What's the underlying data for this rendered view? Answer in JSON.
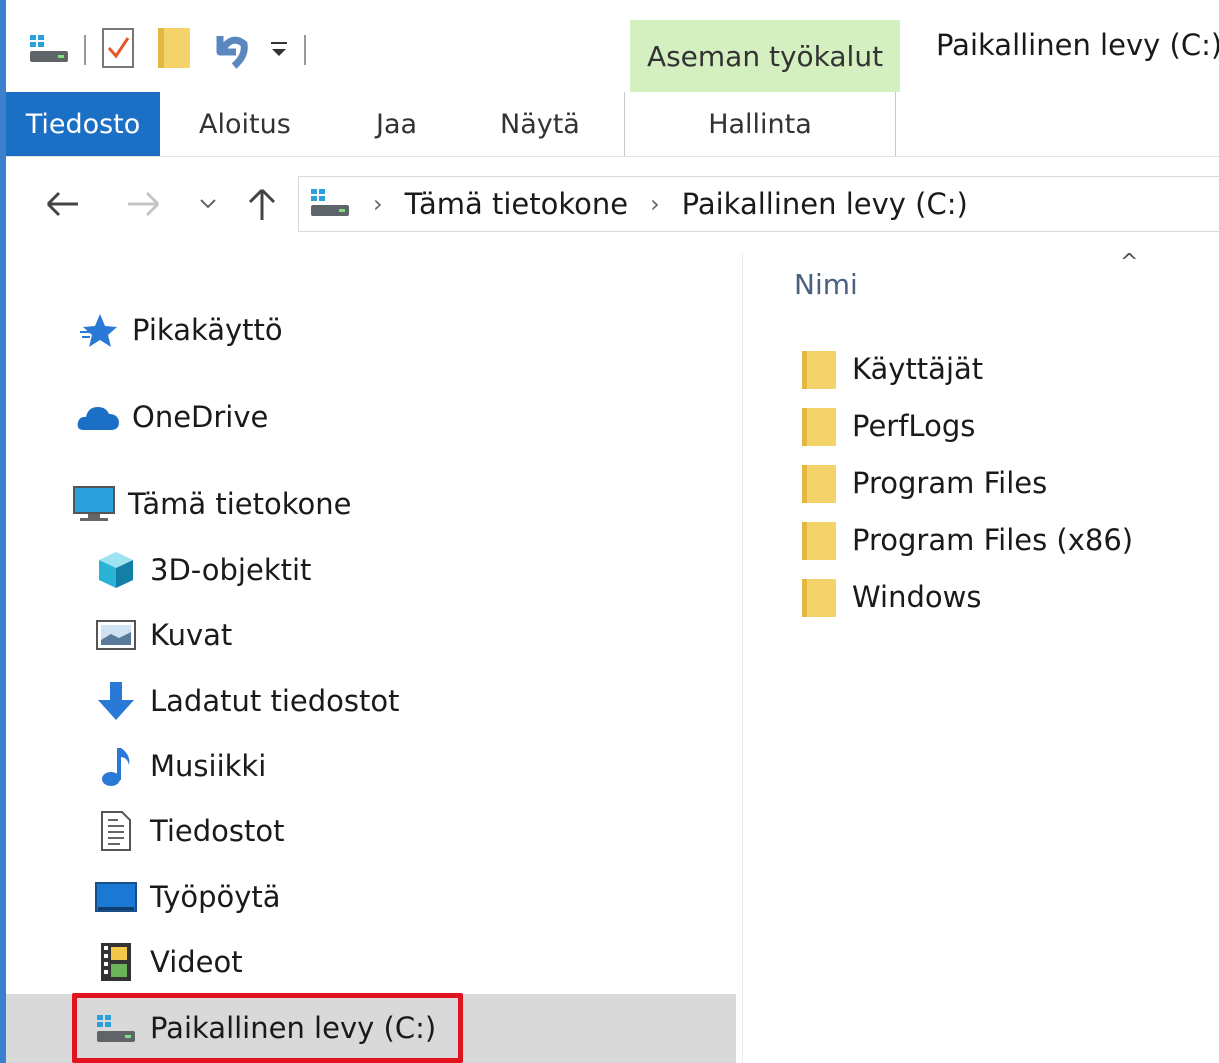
{
  "window": {
    "title": "Paikallinen levy (C:)",
    "context_tool_group": "Aseman työkalut"
  },
  "ribbon": {
    "tabs": [
      {
        "label": "Tiedosto"
      },
      {
        "label": "Aloitus"
      },
      {
        "label": "Jaa"
      },
      {
        "label": "Näytä"
      }
    ],
    "context_tab": "Hallinta"
  },
  "address": {
    "crumbs": [
      "Tämä tietokone",
      "Paikallinen levy (C:)"
    ]
  },
  "nav_pane": {
    "items": [
      {
        "label": "Pikakäyttö",
        "icon": "quick-access-star-icon"
      },
      {
        "label": "OneDrive",
        "icon": "onedrive-cloud-icon"
      },
      {
        "label": "Tämä tietokone",
        "icon": "computer-icon"
      },
      {
        "label": "3D-objektit",
        "icon": "3d-objects-icon"
      },
      {
        "label": "Kuvat",
        "icon": "pictures-icon"
      },
      {
        "label": "Ladatut tiedostot",
        "icon": "downloads-icon"
      },
      {
        "label": "Musiikki",
        "icon": "music-icon"
      },
      {
        "label": "Tiedostot",
        "icon": "documents-icon"
      },
      {
        "label": "Työpöytä",
        "icon": "desktop-icon"
      },
      {
        "label": "Videot",
        "icon": "videos-icon"
      },
      {
        "label": "Paikallinen levy (C:)",
        "icon": "local-disk-icon",
        "selected": true
      }
    ]
  },
  "content": {
    "column_header": "Nimi",
    "files": [
      {
        "name": "Käyttäjät"
      },
      {
        "name": "PerfLogs"
      },
      {
        "name": "Program Files"
      },
      {
        "name": "Program Files (x86)"
      },
      {
        "name": "Windows"
      }
    ]
  },
  "colors": {
    "accent": "#1b6fc4",
    "context_tab_bg": "#d4efc0",
    "selection_bg": "#d9d9d9",
    "highlight_border": "#e0141e",
    "folder": "#f5d36b"
  }
}
